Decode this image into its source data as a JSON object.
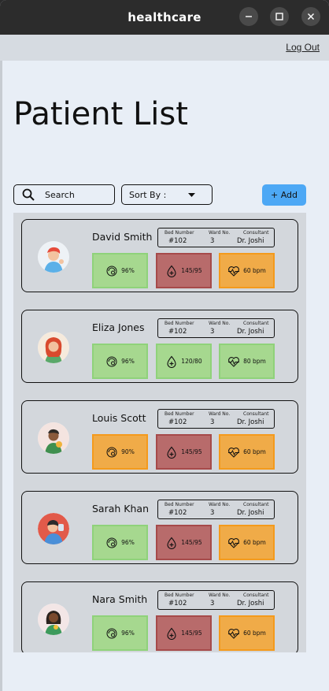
{
  "window": {
    "title": "healthcare"
  },
  "topbar": {
    "logout_label": "Log Out"
  },
  "page": {
    "title": "Patient List"
  },
  "toolbar": {
    "search_placeholder": "Search",
    "sort_label": "Sort By :",
    "add_label": "+ Add"
  },
  "info_headers": {
    "bed": "Bed Number",
    "ward": "Ward No.",
    "consultant": "Consultant"
  },
  "colors": {
    "ok": "#a6d88f",
    "critical": "#b86b6b",
    "warning": "#f0ab48",
    "add_button": "#4da8f5"
  },
  "patients": [
    {
      "name": "David Smith",
      "bed": "#102",
      "ward": "3",
      "consultant": "Dr. Joshi",
      "spo2": "96%",
      "bp": "145/95",
      "hr": "60 bpm",
      "spo2_status": "green",
      "bp_status": "red",
      "hr_status": "orange"
    },
    {
      "name": "Eliza Jones",
      "bed": "#102",
      "ward": "3",
      "consultant": "Dr. Joshi",
      "spo2": "96%",
      "bp": "120/80",
      "hr": "80 bpm",
      "spo2_status": "green",
      "bp_status": "green",
      "hr_status": "green"
    },
    {
      "name": "Louis Scott",
      "bed": "#102",
      "ward": "3",
      "consultant": "Dr. Joshi",
      "spo2": "90%",
      "bp": "145/95",
      "hr": "60 bpm",
      "spo2_status": "orange",
      "bp_status": "red",
      "hr_status": "orange"
    },
    {
      "name": "Sarah Khan",
      "bed": "#102",
      "ward": "3",
      "consultant": "Dr. Joshi",
      "spo2": "96%",
      "bp": "145/95",
      "hr": "60 bpm",
      "spo2_status": "green",
      "bp_status": "red",
      "hr_status": "orange"
    },
    {
      "name": "Nara Smith",
      "bed": "#102",
      "ward": "3",
      "consultant": "Dr. Joshi",
      "spo2": "96%",
      "bp": "145/95",
      "hr": "60 bpm",
      "spo2_status": "green",
      "bp_status": "red",
      "hr_status": "orange"
    }
  ],
  "icons": {
    "search": "magnifier-icon",
    "sort": "caret-down-icon",
    "spo2": "oxygen-gauge-icon",
    "bp": "blood-drop-icon",
    "hr": "heartbeat-icon"
  }
}
